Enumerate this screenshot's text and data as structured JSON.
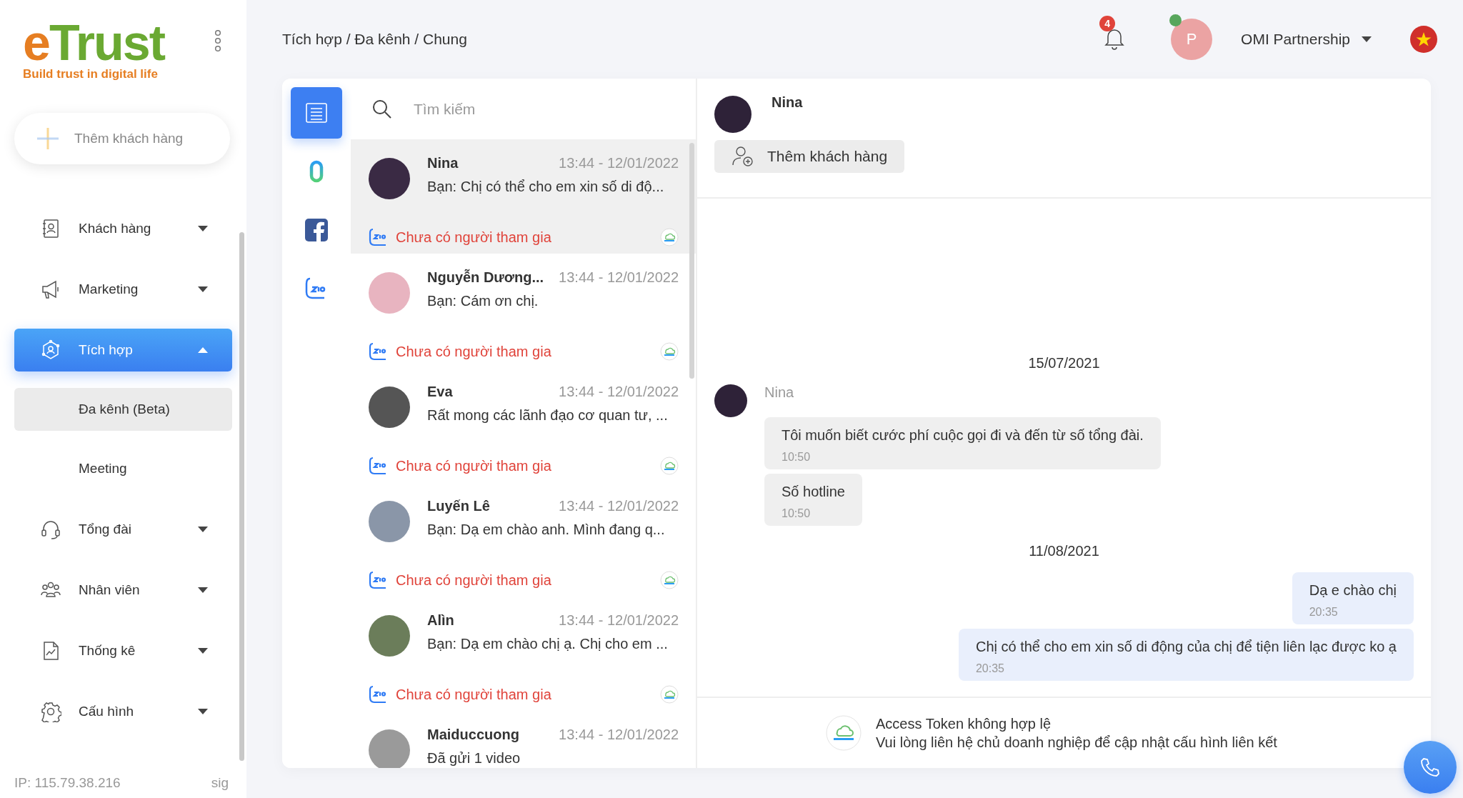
{
  "logo": {
    "first": "e",
    "rest": "Trust",
    "tagline": "Build trust in digital life"
  },
  "add_customer_button": "Thêm khách hàng",
  "menu": [
    {
      "label": "Khách hàng",
      "selected": false,
      "expanded": false
    },
    {
      "label": "Marketing",
      "selected": false,
      "expanded": false
    },
    {
      "label": "Tích hợp",
      "selected": true,
      "expanded": true,
      "children": [
        {
          "label": "Đa kênh (Beta)",
          "selected": true
        },
        {
          "label": "Meeting",
          "selected": false
        }
      ]
    },
    {
      "label": "Tổng đài",
      "selected": false,
      "expanded": false
    },
    {
      "label": "Nhân viên",
      "selected": false,
      "expanded": false
    },
    {
      "label": "Thống kê",
      "selected": false,
      "expanded": false
    },
    {
      "label": "Cấu hình",
      "selected": false,
      "expanded": false
    }
  ],
  "sidebar_footer": {
    "ip": "IP: 115.79.38.216",
    "extra": "sig"
  },
  "breadcrumb": "Tích hợp / Đa kênh / Chung",
  "header": {
    "notification_count": "4",
    "avatar_letter": "P",
    "online": true,
    "account": "OMI Partnership"
  },
  "channels": [
    {
      "kind": "all",
      "selected": true
    },
    {
      "kind": "omi",
      "selected": false
    },
    {
      "kind": "facebook",
      "selected": false
    },
    {
      "kind": "zalo",
      "selected": false
    }
  ],
  "search": {
    "placeholder": "Tìm kiếm"
  },
  "conversations": [
    {
      "name": "Nina",
      "time": "13:44 - 12/01/2022",
      "preview": "Bạn: Chị có thể cho em xin số di độ...",
      "status": "Chưa có người tham gia",
      "selected": true
    },
    {
      "name": "Nguyễn Dương...",
      "time": "13:44 - 12/01/2022",
      "preview": "Bạn: Cám ơn chị.",
      "status": "Chưa có người tham gia",
      "selected": false
    },
    {
      "name": "Eva",
      "time": "13:44 - 12/01/2022",
      "preview": "Rất mong các lãnh đạo cơ quan tư, ...",
      "status": "Chưa có người tham gia",
      "selected": false
    },
    {
      "name": "Luyến Lê",
      "time": "13:44 - 12/01/2022",
      "preview": "Bạn: Dạ em chào anh. Mình đang q...",
      "status": "Chưa có người tham gia",
      "selected": false
    },
    {
      "name": "Alìn",
      "time": "13:44 - 12/01/2022",
      "preview": "Bạn: Dạ em chào chị ạ. Chị cho em ...",
      "status": "Chưa có người tham gia",
      "selected": false
    },
    {
      "name": "Maiduccuong",
      "time": "13:44 - 12/01/2022",
      "preview": "Đã gửi 1 video",
      "selected": false
    }
  ],
  "chat": {
    "name": "Nina",
    "add_button": "Thêm khách hàng",
    "groups": [
      {
        "date": "15/07/2021",
        "sender": "Nina",
        "messages": [
          {
            "kind": "incoming",
            "text": "Tôi muốn biết cước phí cuộc gọi đi và đến từ số tổng đài.",
            "time": "10:50"
          },
          {
            "kind": "incoming",
            "text": "Số hotline",
            "time": "10:50"
          }
        ]
      },
      {
        "date": "11/08/2021",
        "messages": [
          {
            "kind": "outgoing",
            "text": "Dạ e chào chị",
            "time": "20:35"
          },
          {
            "kind": "outgoing",
            "text": "Chị có thể cho em xin số di động của chị để tiện liên lạc được ko ạ",
            "time": "20:35"
          }
        ]
      }
    ],
    "notice": {
      "title": "Access Token không hợp lệ",
      "body": "Vui lòng liên hệ chủ doanh nghiệp để cập nhật cấu hình liên kết"
    }
  }
}
